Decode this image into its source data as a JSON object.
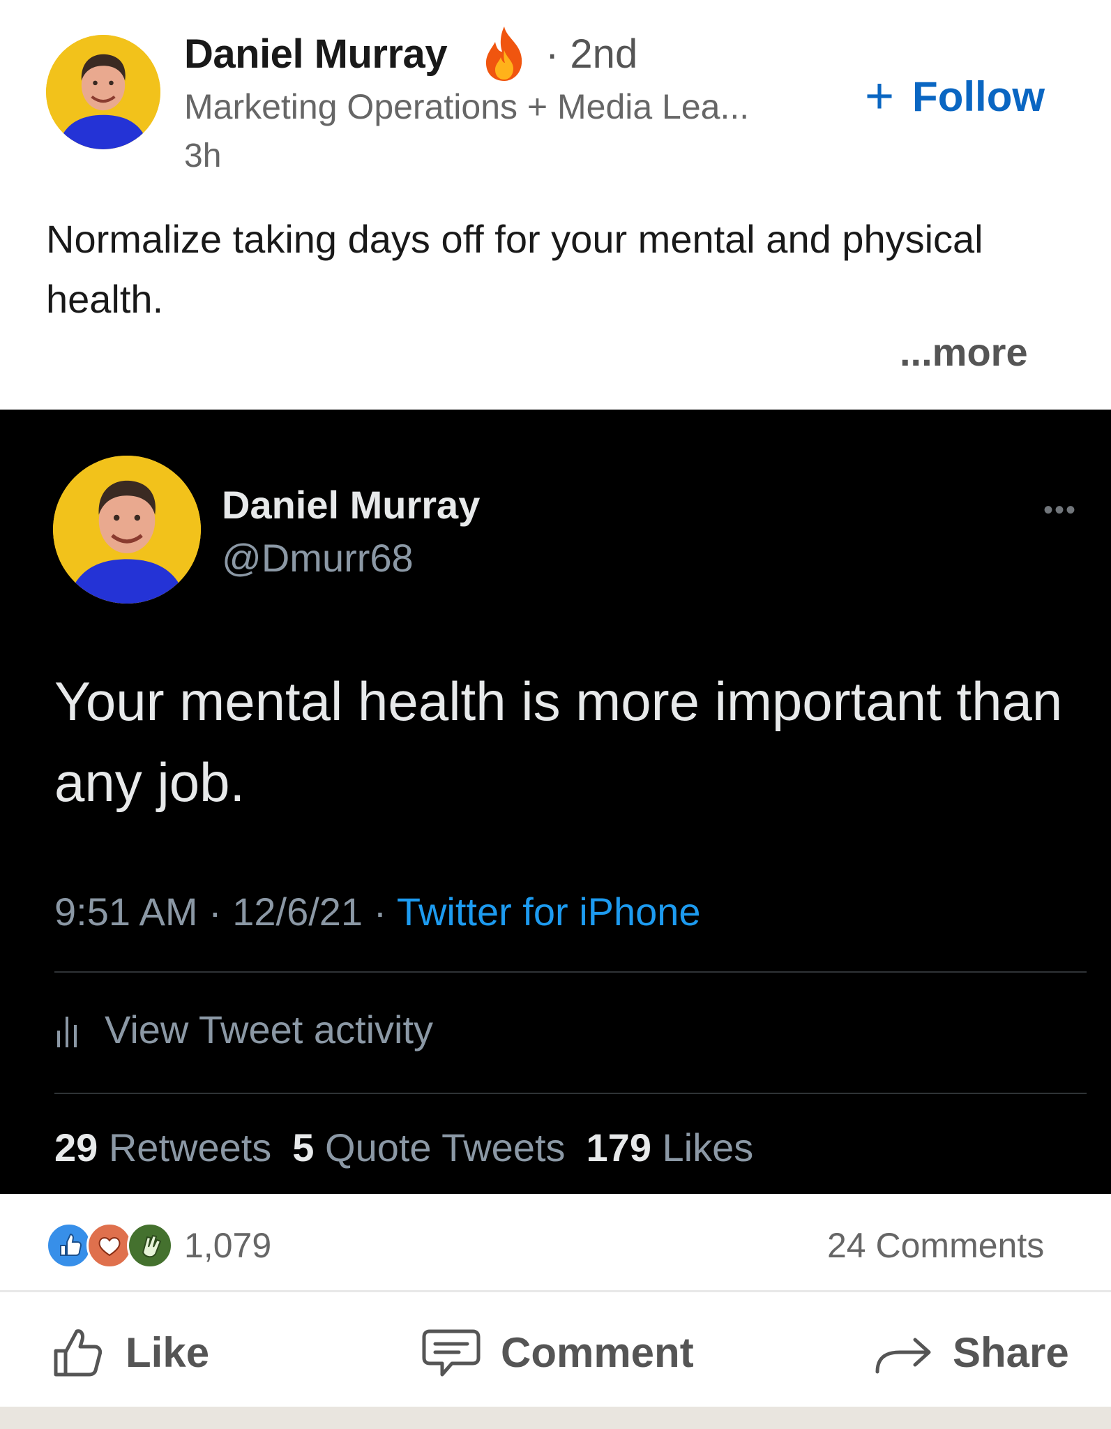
{
  "post": {
    "author": {
      "name": "Daniel Murray",
      "degree": "· 2nd",
      "headline": "Marketing Operations + Media Lea...",
      "time": "3h",
      "badge_icon": "fire-icon"
    },
    "follow_label": "Follow",
    "follow_icon": "+",
    "text": "Normalize taking days off for your mental and physical health.",
    "more_label": "...more"
  },
  "tweet": {
    "name": "Daniel Murray",
    "handle": "@Dmurr68",
    "menu": "•••",
    "text": "Your mental health is more important than any job.",
    "time": "9:51 AM · 12/6/21 · ",
    "source": "Twitter for iPhone",
    "activity_label": "View Tweet activity",
    "stats": {
      "retweets_count": "29",
      "retweets_label": "Retweets",
      "quotes_count": "5",
      "quotes_label": "Quote Tweets",
      "likes_count": "179",
      "likes_label": "Likes"
    }
  },
  "social": {
    "reactions_count": "1,079",
    "comments_label": "24 Comments"
  },
  "actions": {
    "like": "Like",
    "comment": "Comment",
    "share": "Share"
  },
  "colors": {
    "linkedin_blue": "#0a66c2",
    "twitter_blue": "#1d9bf0",
    "tweet_bg": "#000000",
    "avatar_bg": "#f2c21b"
  }
}
